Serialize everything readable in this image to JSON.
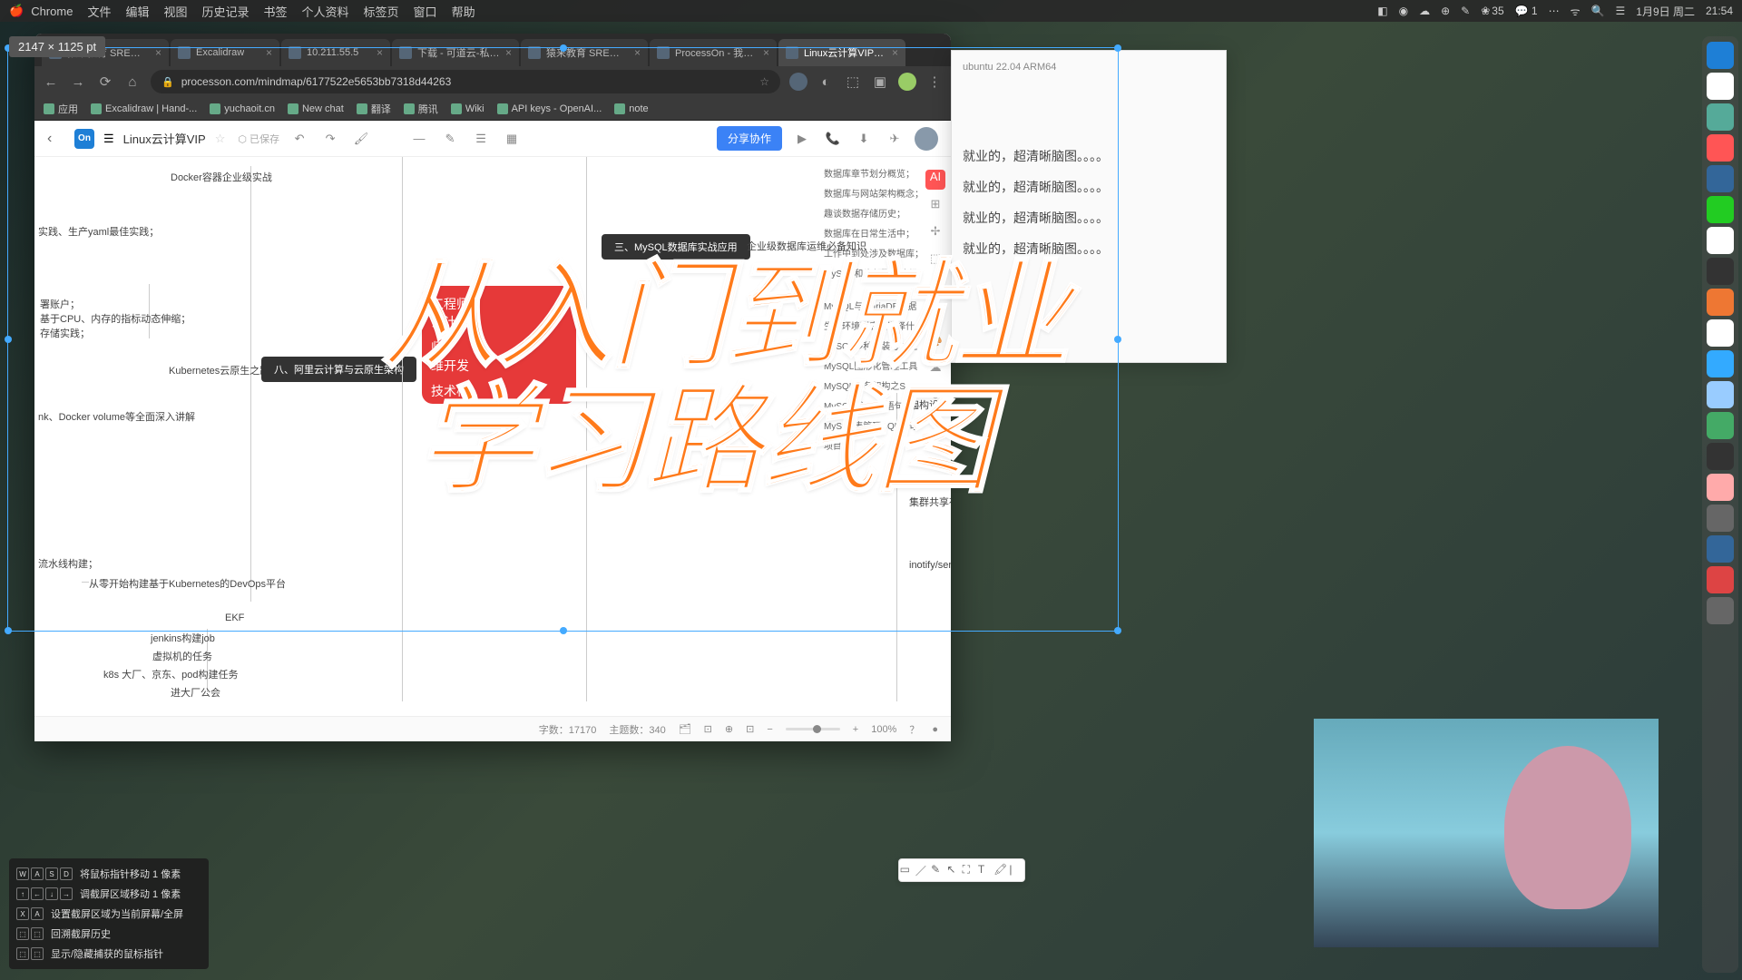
{
  "menubar": {
    "app": "Chrome",
    "items": [
      "文件",
      "编辑",
      "视图",
      "历史记录",
      "书签",
      "个人资料",
      "标签页",
      "窗口",
      "帮助"
    ],
    "right": {
      "battery": "35",
      "date": "1月9日 周二",
      "time": "21:54"
    }
  },
  "dim_tooltip": "2147 × 1125   pt",
  "tabs": [
    {
      "label": "猿来教育 SRE训练营学习计..."
    },
    {
      "label": "Excalidraw"
    },
    {
      "label": "10.211.55.5"
    },
    {
      "label": "下载 - 可道云-私有云存储&..."
    },
    {
      "label": "猿来教育 SRE训练营学习计..."
    },
    {
      "label": "ProcessOn - 我的文件"
    },
    {
      "label": "Linux云计算VIP-ProcessOn",
      "active": true
    }
  ],
  "addr": {
    "url": "processon.com/mindmap/6177522e5653bb7318d44263"
  },
  "bookmarks": [
    "应用",
    "Excalidraw | Hand-...",
    "yuchaoit.cn",
    "New chat",
    "翻译",
    "腾讯",
    "Wiki",
    "API keys - OpenAI...",
    "note"
  ],
  "po": {
    "title": "Linux云计算VIP",
    "saved": "⬡ 已保存",
    "share": "分享协作"
  },
  "nodes": {
    "docker": "Docker容器企业级实战",
    "yaml": "实践、生产yaml最佳实践；",
    "cpu": "署账户；\n基于CPU、内存的指标动态伸缩；\n存储实践；",
    "k8sroad": "Kubernetes云原生之路",
    "volumes": "nk、Docker volume等全面深入讲解",
    "pipeline": "流水线构建；",
    "devops": "从零开始构建基于Kubernetes的DevOps平台",
    "ekf": "EKF",
    "jenkins": "jenkins构建job",
    "vm": "虚拟机的任务",
    "k8sbig": "k8s 大厂、京东、pod构建任务",
    "bigco": "进大厂公会",
    "aliyun": "八、阿里云计算与云原生架构",
    "mysql": "三、MySQL数据库实战应用",
    "mysqlknow": "企业级数据库运维必备知识",
    "arch": "架构设计原理",
    "cluster": "集群共享存储",
    "inotify": "inotify/sersync",
    "badge1": "工程师",
    "badge2": "云计",
    "badge3": "师",
    "badge4": "维开发",
    "badge5": "技术栈"
  },
  "outline": [
    "数据库章节划分概览；",
    "数据库与网站架构概念；",
    "趣谈数据存储历史；",
    "数据库在日常生活中；",
    "工作中到处涉及数据库；",
    "MySQL和头部联盟的经",
    "MySQL与MariaDB数据",
    "生产环境到底该选择什么",
    "MySQL多种安装方式之",
    "MySQL图形化管理工具",
    "MySQL服务架构之Serve",
    "MySQ核心SQL语句之D",
    "MySQL表管理SQL语句",
    "项目方"
  ],
  "light_panel": {
    "ub": "ubuntu 22.04 ARM64",
    "lines": [
      "就业的，超清晰脑图。。。。",
      "就业的，超清晰脑图。。。。",
      "就业的，超清晰脑图。。。。",
      "就业的，超清晰脑图。。。。"
    ]
  },
  "statusbar": {
    "chars": "字数：17170",
    "topics": "主题数：340",
    "zoom": "100%"
  },
  "overlay": {
    "l1": "从入门到就业",
    "l2": "学习路线图"
  },
  "shortcuts": [
    {
      "keys": [
        "W",
        "A",
        "S",
        "D"
      ],
      "text": "将鼠标指针移动 1 像素"
    },
    {
      "keys": [
        "↑",
        "←",
        "↓",
        "→"
      ],
      "text": "调截屏区域移动 1 像素"
    },
    {
      "keys": [
        "X",
        "A"
      ],
      "text": "设置截屏区域为当前屏幕/全屏"
    },
    {
      "keys": [
        "",
        ""
      ],
      "text": "回溯截屏历史"
    },
    {
      "keys": [
        "",
        ""
      ],
      "text": "显示/隐藏捕获的鼠标指针"
    }
  ]
}
